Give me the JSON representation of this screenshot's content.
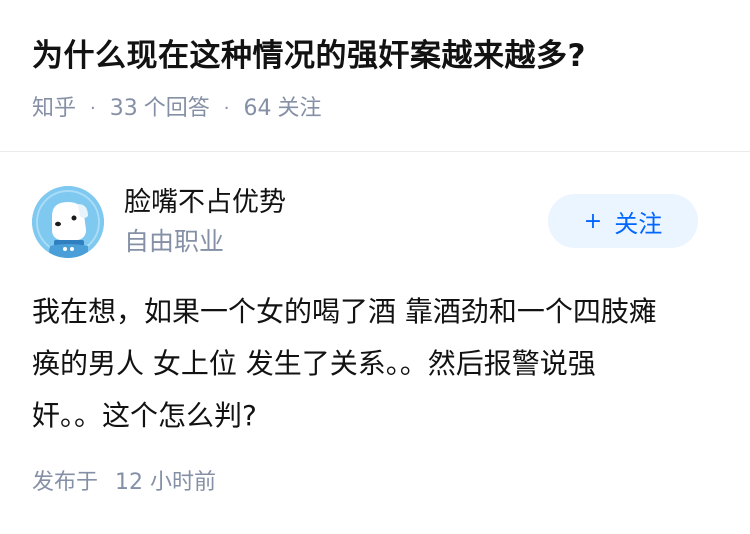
{
  "question": {
    "title": "为什么现在这种情况的强奸案越来越多?",
    "meta": {
      "source": "知乎",
      "separator": "·",
      "answers_count": "33",
      "answers_label": "个回答",
      "followers_count": "64",
      "followers_label": "关注"
    }
  },
  "author": {
    "name": "脸嘴不占优势",
    "bio": "自由职业",
    "avatar_icon": "cartoon-dog-avatar-icon",
    "avatar_color": "#7fc8f0"
  },
  "follow_button": {
    "plus": "+",
    "label": "关注",
    "bg_color": "#ebf5ff",
    "text_color": "#0066ff"
  },
  "answer": {
    "lines": [
      "我在想，如果一个女的喝了酒 靠酒劲和一个四肢瘫",
      "痪的男人 女上位 发生了关系。。然后报警说强",
      "奸。。这个怎么判?"
    ]
  },
  "publish": {
    "label": "发布于",
    "time": "12 小时前"
  }
}
